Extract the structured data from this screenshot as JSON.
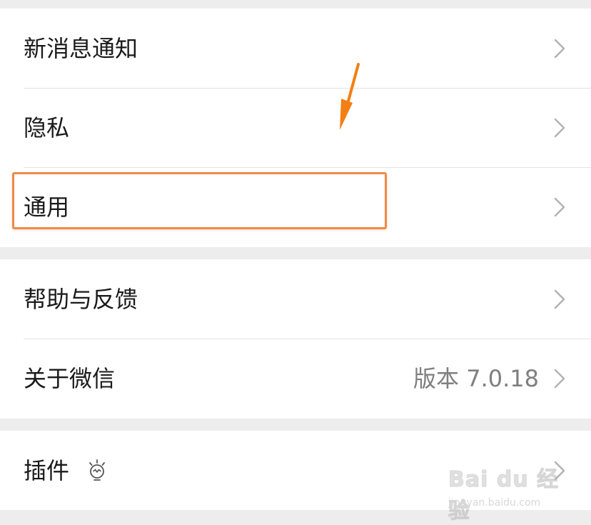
{
  "settings": {
    "group1": {
      "new_message_notification": "新消息通知",
      "privacy": "隐私",
      "general": "通用"
    },
    "group2": {
      "help_feedback": "帮助与反馈",
      "about_wechat": "关于微信",
      "version_value": "版本 7.0.18"
    },
    "group3": {
      "plugins": "插件"
    }
  },
  "icons": {
    "chevron": "chevron-right-icon",
    "plugin_badge": "lightbulb-icon"
  },
  "annotation": {
    "highlight_color": "#ef8a4a",
    "arrow_color": "#f47f12"
  },
  "watermark": {
    "logo_text": "Bai du 经验",
    "sub_text": "jingyan.baidu.com"
  }
}
